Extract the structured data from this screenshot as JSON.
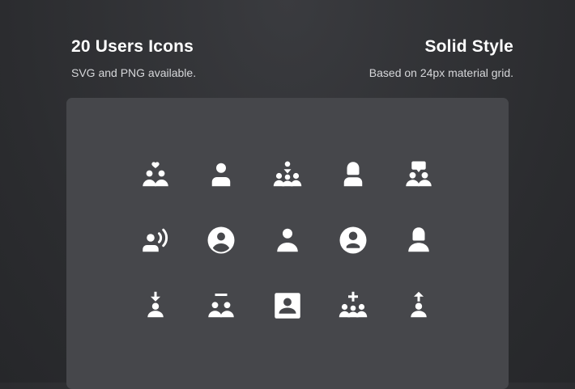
{
  "header": {
    "title_left": "20 Users Icons",
    "subtitle_left": "SVG and PNG available.",
    "title_right": "Solid Style",
    "subtitle_right": "Based on 24px material grid."
  },
  "icons": [
    "users-heart-icon",
    "user-icon",
    "users-network-icon",
    "user-female-icon",
    "users-chat-icon",
    "user-voice-icon",
    "user-circle-icon",
    "user-alt-icon",
    "user-circle-alt-icon",
    "user-female-alt-icon",
    "user-download-icon",
    "users-remove-icon",
    "user-square-icon",
    "users-add-icon",
    "user-upload-icon"
  ],
  "colors": {
    "background": "#2b2c2f",
    "panel": "#46474b",
    "icon": "#ffffff",
    "text": "#ffffff"
  }
}
